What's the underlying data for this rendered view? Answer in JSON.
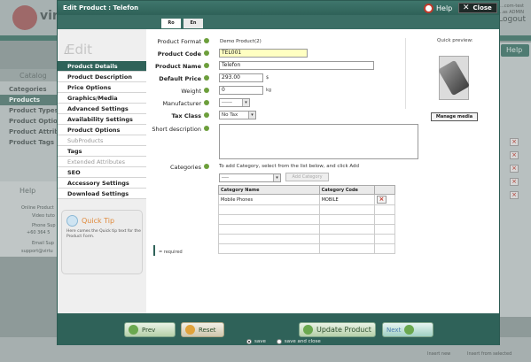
{
  "background": {
    "logo_text": "virt",
    "top_right_lines": [
      "...com-test",
      "...as ADMIN"
    ],
    "logout": "Logout",
    "catalog_title": "Catalog",
    "catalog_items": [
      "Categories",
      "Products",
      "Product Types",
      "Product Options",
      "Product Attributes",
      "Product Tags"
    ],
    "help_title": "Help",
    "help_lines": [
      "Online Product",
      "Video tuto",
      "Phone Sup",
      "+60 364 5",
      "Email Sup",
      "support@virtu"
    ],
    "right_help": "Help",
    "bottom_left": "Insert new",
    "bottom_right": "Insert from selected"
  },
  "modal": {
    "title": "Edit Product : Telefon",
    "help_label": "Help",
    "close_label": "Close",
    "lang_tabs": [
      "Ro",
      "En"
    ],
    "edit_heading": "Edit",
    "nav": [
      {
        "label": "Product Details",
        "state": "active"
      },
      {
        "label": "Product Description",
        "state": "normal"
      },
      {
        "label": "Price Options",
        "state": "normal"
      },
      {
        "label": "Graphics/Media",
        "state": "normal"
      },
      {
        "label": "Advanced Settings",
        "state": "normal"
      },
      {
        "label": "Availability Settings",
        "state": "normal"
      },
      {
        "label": "Product Options",
        "state": "normal"
      },
      {
        "label": "SubProducts",
        "state": "muted"
      },
      {
        "label": "Tags",
        "state": "normal"
      },
      {
        "label": "Extended Attributes",
        "state": "muted"
      },
      {
        "label": "SEO",
        "state": "normal"
      },
      {
        "label": "Accessory Settings",
        "state": "normal"
      },
      {
        "label": "Download Settings",
        "state": "normal"
      }
    ],
    "quick_tip": {
      "title": "Quick Tip",
      "text": "Here comes the Quick tip text for the Product Form."
    }
  },
  "form": {
    "product_format": {
      "label": "Product Format",
      "value": "Demo Product(2)"
    },
    "product_code": {
      "label": "Product Code",
      "value": "TEL001"
    },
    "product_name": {
      "label": "Product Name",
      "value": "Telefon"
    },
    "default_price": {
      "label": "Default Price",
      "value": "293.00",
      "unit": "$"
    },
    "weight": {
      "label": "Weight",
      "value": "0",
      "unit": "kg"
    },
    "manufacturer": {
      "label": "Manufacturer",
      "value": "------"
    },
    "tax_class": {
      "label": "Tax Class",
      "value": "No Tax"
    },
    "short_description": {
      "label": "Short description",
      "value": ""
    },
    "categories": {
      "label": "Categories",
      "hint": "To add Category, select from the list below, and click Add",
      "select_value": "----",
      "add_button": "Add Category",
      "columns": [
        "Category Name",
        "Category Code"
      ],
      "rows": [
        {
          "name": "Mobile Phones",
          "code": "MOBILE"
        }
      ]
    },
    "required_note": "= required",
    "quick_preview": "Quick preview:",
    "manage_media": "Manage media"
  },
  "footer": {
    "prev": "Prev",
    "reset": "Reset",
    "update": "Update Product",
    "next": "Next",
    "save_options": [
      "save",
      "save and close"
    ],
    "selected_save": "save"
  }
}
